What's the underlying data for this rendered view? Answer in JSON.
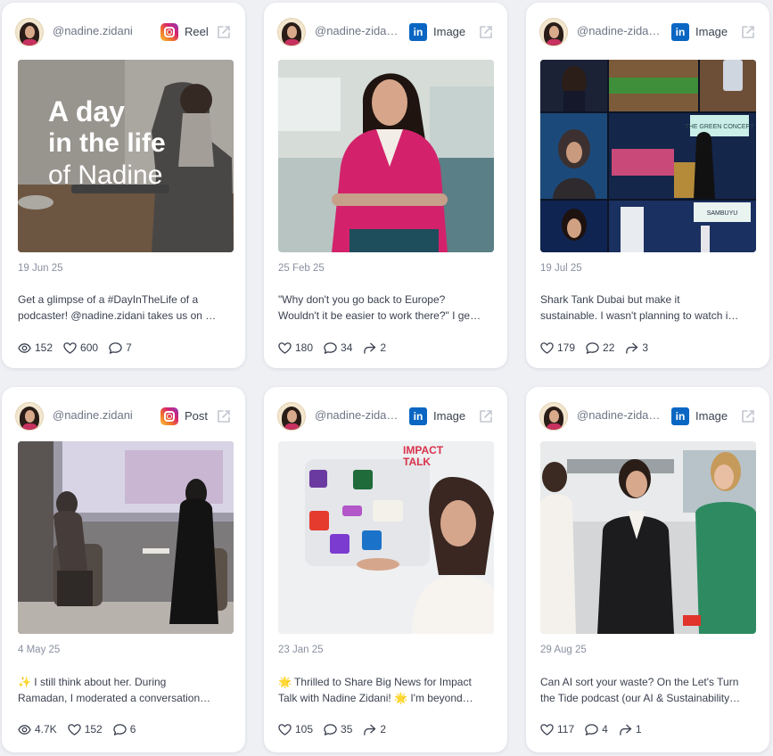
{
  "cards": [
    {
      "handle": "@nadine.zidani",
      "platform_icon": "instagram-icon",
      "type": "Reel",
      "date": "19 Jun 25",
      "caption_line1": "Get a glimpse of a #DayInTheLife of a",
      "caption_line2": "podcaster! @nadine.zidani takes us on …",
      "overlay": {
        "line1": "A day",
        "line2": "in the life",
        "line3": "of Nadine"
      },
      "metrics": [
        {
          "icon": "eye-icon",
          "value": "152"
        },
        {
          "icon": "heart-icon",
          "value": "600"
        },
        {
          "icon": "comment-icon",
          "value": "7"
        }
      ]
    },
    {
      "handle": "@nadine-zida…",
      "platform_icon": "linkedin-icon",
      "type": "Image",
      "date": "25 Feb 25",
      "caption_line1": "\"Why don't you go back to Europe?",
      "caption_line2": "Wouldn't it be easier to work there?\" I ge…",
      "metrics": [
        {
          "icon": "heart-icon",
          "value": "180"
        },
        {
          "icon": "comment-icon",
          "value": "34"
        },
        {
          "icon": "share-icon",
          "value": "2"
        }
      ]
    },
    {
      "handle": "@nadine-zida…",
      "platform_icon": "linkedin-icon",
      "type": "Image",
      "date": "19 Jul 25",
      "caption_line1": "Shark Tank Dubai but make it",
      "caption_line2": "sustainable. I wasn't planning to watch i…",
      "sign_text_1": "THE GREEN CONCEPT",
      "sign_text_2": "SAMBUYU",
      "metrics": [
        {
          "icon": "heart-icon",
          "value": "179"
        },
        {
          "icon": "comment-icon",
          "value": "22"
        },
        {
          "icon": "share-icon",
          "value": "3"
        }
      ]
    },
    {
      "handle": "@nadine.zidani",
      "platform_icon": "instagram-icon",
      "type": "Post",
      "date": "4 May 25",
      "caption_line1": "✨ I still think about her. During",
      "caption_line2": "Ramadan, I moderated a conversation…",
      "metrics": [
        {
          "icon": "eye-icon",
          "value": "4.7K"
        },
        {
          "icon": "heart-icon",
          "value": "152"
        },
        {
          "icon": "comment-icon",
          "value": "6"
        }
      ]
    },
    {
      "handle": "@nadine-zida…",
      "platform_icon": "linkedin-icon",
      "type": "Image",
      "date": "23 Jan 25",
      "caption_line1": "🌟 Thrilled to Share Big News for Impact",
      "caption_line2": "Talk with Nadine Zidani! 🌟 I'm beyond…",
      "impact_talk_line1": "IMPACT",
      "impact_talk_line2": "TALK",
      "metrics": [
        {
          "icon": "heart-icon",
          "value": "105"
        },
        {
          "icon": "comment-icon",
          "value": "35"
        },
        {
          "icon": "share-icon",
          "value": "2"
        }
      ]
    },
    {
      "handle": "@nadine-zida…",
      "platform_icon": "linkedin-icon",
      "type": "Image",
      "date": "29 Aug 25",
      "caption_line1": "Can AI sort your waste? On the Let's Turn",
      "caption_line2": "the Tide podcast (our AI & Sustainability…",
      "metrics": [
        {
          "icon": "heart-icon",
          "value": "117"
        },
        {
          "icon": "comment-icon",
          "value": "4"
        },
        {
          "icon": "share-icon",
          "value": "1"
        }
      ]
    }
  ],
  "colors": {
    "page_bg": "#eef0f4",
    "card_bg": "#ffffff",
    "linkedin_blue": "#0a66c2",
    "muted_text": "#8a90a0",
    "body_text": "#3b4150"
  }
}
